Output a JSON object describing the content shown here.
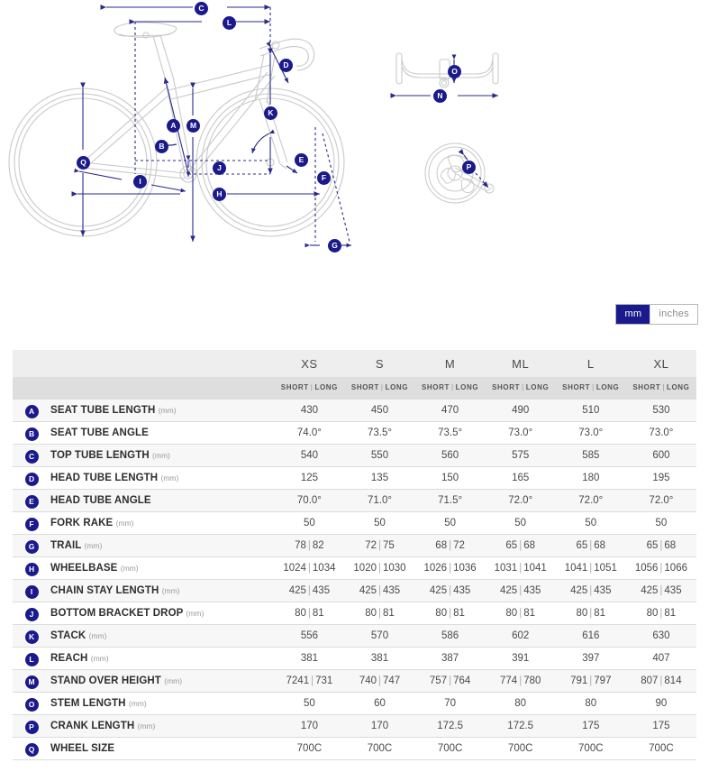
{
  "units_toggle": {
    "mm_label": "mm",
    "inches_label": "inches",
    "active": "mm"
  },
  "diagram": {
    "callouts": {
      "A": "A",
      "B": "B",
      "C": "C",
      "D": "D",
      "E": "E",
      "F": "F",
      "G": "G",
      "G2": "G",
      "H": "H",
      "I": "I",
      "J": "J",
      "K": "K",
      "L": "L",
      "M": "M",
      "O": "O",
      "N": "N",
      "P": "P",
      "Q": "Q"
    }
  },
  "table": {
    "sizes": [
      "XS",
      "S",
      "M",
      "ML",
      "L",
      "XL"
    ],
    "subheader": {
      "short": "SHORT",
      "long": "LONG",
      "separator": "|"
    },
    "rows": [
      {
        "badge": "A",
        "label": "SEAT TUBE LENGTH",
        "unit": "(mm)",
        "values": [
          "430",
          "450",
          "470",
          "490",
          "510",
          "530"
        ]
      },
      {
        "badge": "B",
        "label": "SEAT TUBE ANGLE",
        "unit": "",
        "values": [
          "74.0°",
          "73.5°",
          "73.5°",
          "73.0°",
          "73.0°",
          "73.0°"
        ]
      },
      {
        "badge": "C",
        "label": "TOP TUBE LENGTH",
        "unit": "(mm)",
        "values": [
          "540",
          "550",
          "560",
          "575",
          "585",
          "600"
        ]
      },
      {
        "badge": "D",
        "label": "HEAD TUBE LENGTH",
        "unit": "(mm)",
        "values": [
          "125",
          "135",
          "150",
          "165",
          "180",
          "195"
        ]
      },
      {
        "badge": "E",
        "label": "HEAD TUBE ANGLE",
        "unit": "",
        "values": [
          "70.0°",
          "71.0°",
          "71.5°",
          "72.0°",
          "72.0°",
          "72.0°"
        ]
      },
      {
        "badge": "F",
        "label": "FORK RAKE",
        "unit": "(mm)",
        "values": [
          "50",
          "50",
          "50",
          "50",
          "50",
          "50"
        ]
      },
      {
        "badge": "G",
        "label": "TRAIL",
        "unit": "(mm)",
        "values": [
          "78 | 82",
          "72 | 75",
          "68 | 72",
          "65 | 68",
          "65 | 68",
          "65 | 68"
        ]
      },
      {
        "badge": "H",
        "label": "WHEELBASE",
        "unit": "(mm)",
        "values": [
          "1024 | 1034",
          "1020 | 1030",
          "1026 | 1036",
          "1031 | 1041",
          "1041 | 1051",
          "1056 | 1066"
        ]
      },
      {
        "badge": "I",
        "label": "CHAIN STAY LENGTH",
        "unit": "(mm)",
        "values": [
          "425 | 435",
          "425 | 435",
          "425 | 435",
          "425 | 435",
          "425 | 435",
          "425 | 435"
        ]
      },
      {
        "badge": "J",
        "label": "BOTTOM BRACKET DROP",
        "unit": "(mm)",
        "values": [
          "80 | 81",
          "80 | 81",
          "80 | 81",
          "80 | 81",
          "80 | 81",
          "80 | 81"
        ]
      },
      {
        "badge": "K",
        "label": "STACK",
        "unit": "(mm)",
        "values": [
          "556",
          "570",
          "586",
          "602",
          "616",
          "630"
        ]
      },
      {
        "badge": "L",
        "label": "REACH",
        "unit": "(mm)",
        "values": [
          "381",
          "381",
          "387",
          "391",
          "397",
          "407"
        ]
      },
      {
        "badge": "M",
        "label": "STAND OVER HEIGHT",
        "unit": "(mm)",
        "values": [
          "7241 | 731",
          "740 | 747",
          "757 | 764",
          "774 | 780",
          "791 | 797",
          "807 | 814"
        ]
      },
      {
        "badge": "O",
        "label": "STEM LENGTH",
        "unit": "(mm)",
        "values": [
          "50",
          "60",
          "70",
          "80",
          "80",
          "90"
        ]
      },
      {
        "badge": "P",
        "label": "CRANK LENGTH",
        "unit": "(mm)",
        "values": [
          "170",
          "170",
          "172.5",
          "172.5",
          "175",
          "175"
        ]
      },
      {
        "badge": "Q",
        "label": "WHEEL SIZE",
        "unit": "",
        "values": [
          "700C",
          "700C",
          "700C",
          "700C",
          "700C",
          "700C"
        ]
      }
    ]
  },
  "colors": {
    "navy": "#1a1a8c",
    "header_light": "#eeeeee",
    "header_dark": "#dedede",
    "row_stripe": "#f7f7f7",
    "bike_outline": "#c9c9c9"
  }
}
